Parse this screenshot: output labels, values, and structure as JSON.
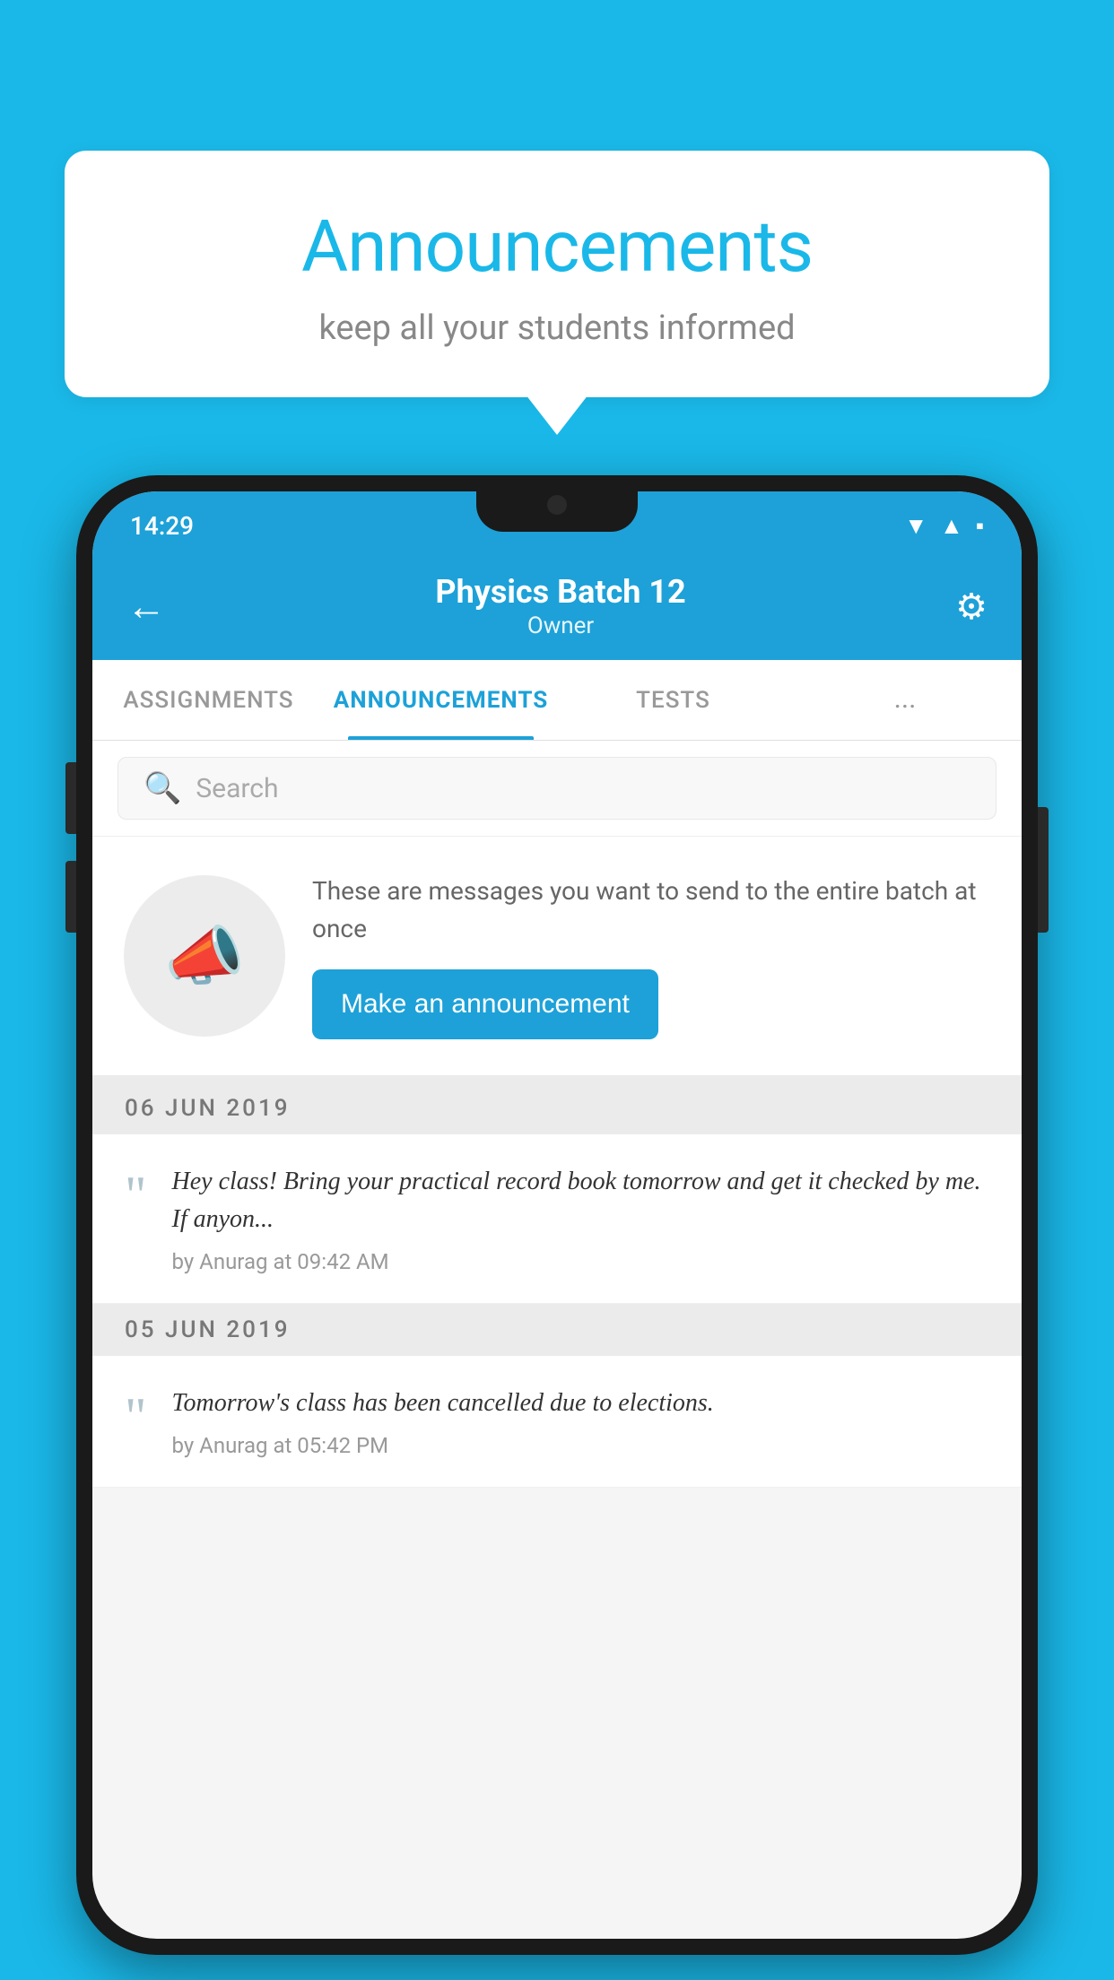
{
  "background_color": "#1ab8e8",
  "speech_bubble": {
    "title": "Announcements",
    "subtitle": "keep all your students informed"
  },
  "phone": {
    "status_bar": {
      "time": "14:29",
      "icons": [
        "wifi",
        "signal",
        "battery"
      ]
    },
    "header": {
      "back_label": "←",
      "title": "Physics Batch 12",
      "subtitle": "Owner",
      "gear_label": "⚙"
    },
    "tabs": [
      {
        "label": "ASSIGNMENTS",
        "active": false
      },
      {
        "label": "ANNOUNCEMENTS",
        "active": true
      },
      {
        "label": "TESTS",
        "active": false
      },
      {
        "label": "...",
        "active": false
      }
    ],
    "search": {
      "placeholder": "Search"
    },
    "announcement_prompt": {
      "description": "These are messages you want to send to the entire batch at once",
      "button_label": "Make an announcement"
    },
    "announcements": [
      {
        "date": "06  JUN  2019",
        "text": "Hey class! Bring your practical record book tomorrow and get it checked by me. If anyon...",
        "meta": "by Anurag at 09:42 AM"
      },
      {
        "date": "05  JUN  2019",
        "text": "Tomorrow's class has been cancelled due to elections.",
        "meta": "by Anurag at 05:42 PM"
      }
    ]
  }
}
